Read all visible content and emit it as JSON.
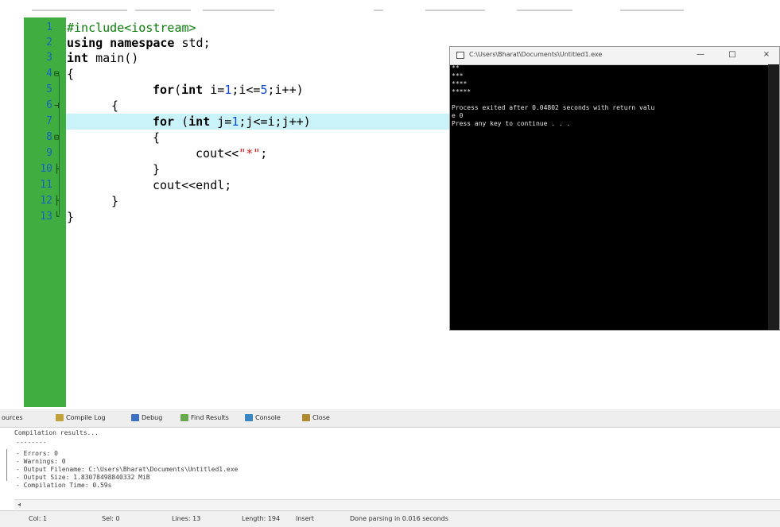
{
  "editor": {
    "line_numbers": [
      "1",
      "2",
      "3",
      "4",
      "5",
      "6",
      "7",
      "8",
      "9",
      "10",
      "11",
      "12",
      "13"
    ],
    "lines": [
      {
        "parts": [
          {
            "t": "#include<iostream>",
            "c": "pp"
          }
        ]
      },
      {
        "parts": [
          {
            "t": "using namespace",
            "c": "kw"
          },
          {
            "t": " std;",
            "c": ""
          }
        ]
      },
      {
        "parts": [
          {
            "t": "int",
            "c": "kw"
          },
          {
            "t": " main()",
            "c": ""
          }
        ]
      },
      {
        "parts": [
          {
            "t": "{",
            "c": ""
          }
        ]
      },
      {
        "parts": [
          {
            "t": "for",
            "c": "kw"
          },
          {
            "t": "(",
            "c": ""
          },
          {
            "t": "int",
            "c": "kw"
          },
          {
            "t": " i=",
            "c": ""
          },
          {
            "t": "1",
            "c": "num"
          },
          {
            "t": ";i<=",
            "c": ""
          },
          {
            "t": "5",
            "c": "num"
          },
          {
            "t": ";i++)",
            "c": ""
          }
        ]
      },
      {
        "parts": [
          {
            "t": "{",
            "c": ""
          }
        ]
      },
      {
        "parts": [
          {
            "t": "for",
            "c": "kw"
          },
          {
            "t": " (",
            "c": ""
          },
          {
            "t": "int",
            "c": "kw"
          },
          {
            "t": " j=",
            "c": ""
          },
          {
            "t": "1",
            "c": "num"
          },
          {
            "t": ";j<=i;j++)",
            "c": ""
          }
        ]
      },
      {
        "parts": [
          {
            "t": "{",
            "c": ""
          }
        ]
      },
      {
        "parts": [
          {
            "t": "cout<<",
            "c": ""
          },
          {
            "t": "\"*\"",
            "c": "str"
          },
          {
            "t": ";",
            "c": ""
          }
        ]
      },
      {
        "parts": [
          {
            "t": "}",
            "c": ""
          }
        ]
      },
      {
        "parts": [
          {
            "t": "cout<<endl;",
            "c": ""
          }
        ]
      },
      {
        "parts": [
          {
            "t": "}",
            "c": ""
          }
        ]
      },
      {
        "parts": [
          {
            "t": "}",
            "c": ""
          }
        ]
      }
    ]
  },
  "console": {
    "title": "C:\\Users\\Bharat\\Documents\\Untitled1.exe",
    "minimize": "—",
    "maximize": "□",
    "close": "×",
    "lines": [
      "**",
      "***",
      "****",
      "*****",
      "",
      "Process exited after 0.04802 seconds with return valu",
      "e 0",
      "Press any key to continue . . ."
    ]
  },
  "bottom": {
    "tabs": [
      {
        "label": "ources",
        "icon_color": ""
      },
      {
        "label": "Compile Log",
        "icon_color": "#c2a23a"
      },
      {
        "label": "Debug",
        "icon_color": "#3a6fc2"
      },
      {
        "label": "Find Results",
        "icon_color": "#6aa84f"
      },
      {
        "label": "Console",
        "icon_color": "#3a86c2"
      },
      {
        "label": "Close",
        "icon_color": "#b08a2e"
      }
    ],
    "log_lines": [
      "Compilation results...",
      "--------",
      "- Errors: 0",
      "- Warnings: 0",
      "- Output Filename: C:\\Users\\Bharat\\Documents\\Untitled1.exe",
      "- Output Size: 1.83078498840332 MiB",
      "- Compilation Time: 0.59s"
    ]
  },
  "status": {
    "line": "Col: 1",
    "sel": "Sel: 0",
    "lines": "Lines: 13",
    "length": "Length: 194",
    "mode": "Insert",
    "parse": "Done parsing in 0.016 seconds"
  }
}
